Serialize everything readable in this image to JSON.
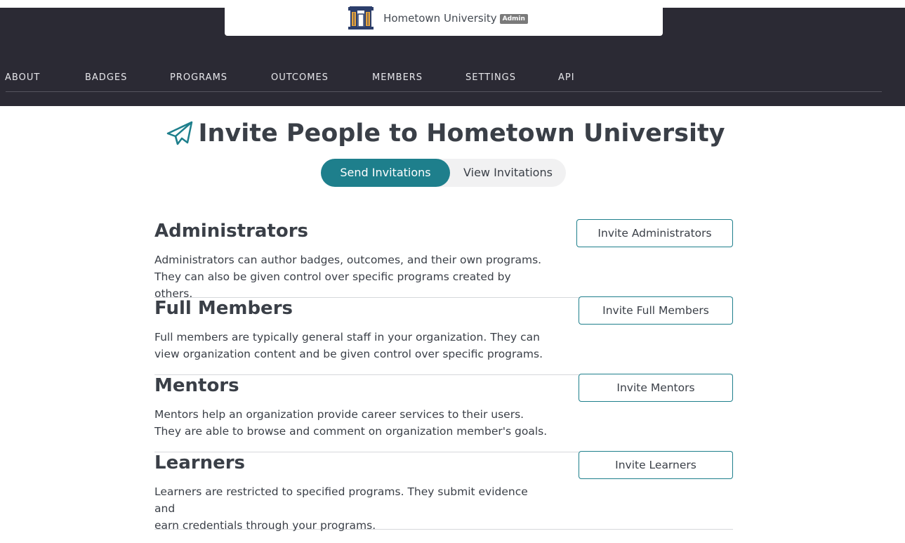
{
  "header": {
    "org_name": "Hometown University",
    "role_badge": "Admin",
    "logo_icon": "columns-logo"
  },
  "nav": {
    "items": [
      "ABOUT",
      "BADGES",
      "PROGRAMS",
      "OUTCOMES",
      "MEMBERS",
      "SETTINGS",
      "API"
    ]
  },
  "page": {
    "title": "Invite People to Hometown University",
    "title_icon": "paper-plane-icon"
  },
  "tabs": {
    "send": "Send Invitations",
    "view": "View Invitations",
    "active": "send"
  },
  "sections": [
    {
      "title": "Administrators",
      "desc_line1": "Administrators can author badges, outcomes, and their own programs.",
      "desc_line2": "They can also be given control over specific programs created by others.",
      "button": "Invite Administrators"
    },
    {
      "title": "Full Members",
      "desc_line1": "Full members are typically general staff in your organization. They can",
      "desc_line2": "view organization content and be given control over specific programs.",
      "button": "Invite Full Members"
    },
    {
      "title": "Mentors",
      "desc_line1": "Mentors help an organization provide career services to their users.",
      "desc_line2": "They are able to browse and comment on organization member's goals.",
      "button": "Invite Mentors"
    },
    {
      "title": "Learners",
      "desc_line1": "Learners are restricted to specified programs. They submit evidence and",
      "desc_line2": "earn credentials through your programs.",
      "button": "Invite Learners"
    }
  ],
  "colors": {
    "header_bg": "#2b2a34",
    "accent": "#1e7f8c",
    "text": "#3a3f47"
  }
}
